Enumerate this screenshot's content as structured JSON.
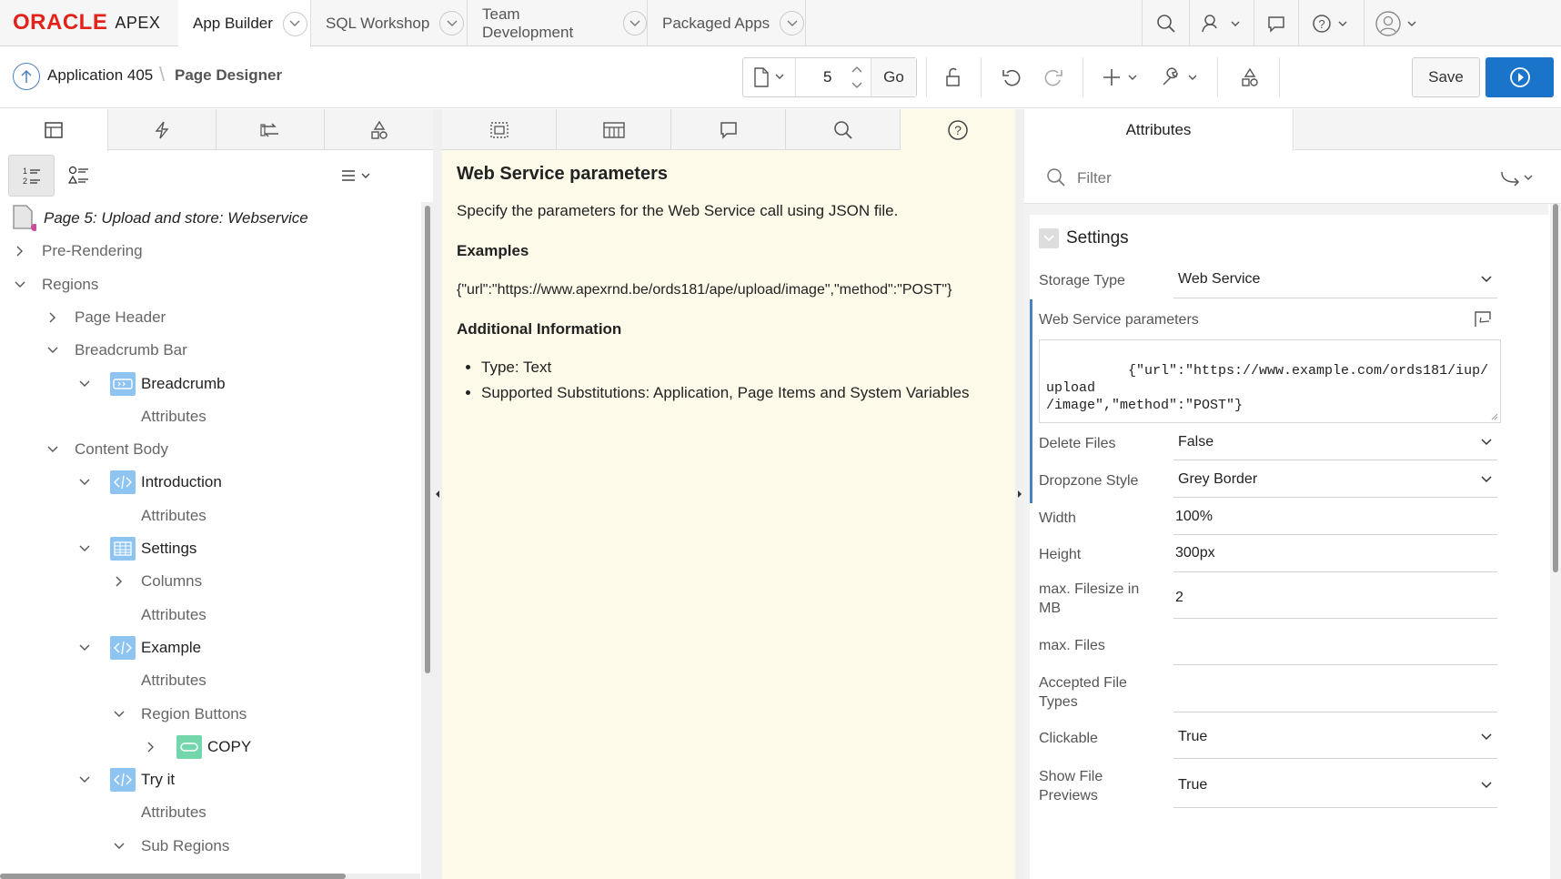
{
  "brand": {
    "oracle": "ORACLE",
    "apex": "APEX"
  },
  "nav": {
    "tabs": [
      {
        "label": "App Builder"
      },
      {
        "label": "SQL Workshop"
      },
      {
        "label": "Team Development"
      },
      {
        "label": "Packaged Apps"
      }
    ],
    "icons": [
      "search-icon",
      "user-icon",
      "chat-icon",
      "help-icon",
      "account-icon"
    ]
  },
  "toolbar": {
    "app": "Application 405",
    "separator": "\\",
    "page_designer": "Page Designer",
    "page_number": "5",
    "go": "Go",
    "save": "Save"
  },
  "tree": {
    "page_title": "Page 5: Upload and store: Webservice",
    "nodes": [
      {
        "label": "Pre-Rendering"
      },
      {
        "label": "Regions"
      },
      {
        "label": "Page Header"
      },
      {
        "label": "Breadcrumb Bar"
      },
      {
        "label": "Breadcrumb"
      },
      {
        "label": "Attributes"
      },
      {
        "label": "Content Body"
      },
      {
        "label": "Introduction"
      },
      {
        "label": "Attributes"
      },
      {
        "label": "Settings"
      },
      {
        "label": "Columns"
      },
      {
        "label": "Attributes"
      },
      {
        "label": "Example"
      },
      {
        "label": "Attributes"
      },
      {
        "label": "Region Buttons"
      },
      {
        "label": "COPY"
      },
      {
        "label": "Try it"
      },
      {
        "label": "Attributes"
      },
      {
        "label": "Sub Regions"
      }
    ]
  },
  "help": {
    "title": "Web Service parameters",
    "description": "Specify the parameters for the Web Service call using JSON file.",
    "examples_heading": "Examples",
    "example": "{\"url\":\"https://www.apexrnd.be/ords181/ape/upload/image\",\"method\":\"POST\"}",
    "additional_heading": "Additional Information",
    "bullets": [
      "Type: Text",
      "Supported Substitutions: Application, Page Items and System Variables"
    ]
  },
  "attributes": {
    "tab": "Attributes",
    "filter_placeholder": "Filter",
    "group": "Settings",
    "storage_type": {
      "label": "Storage Type",
      "value": "Web Service"
    },
    "ws_params": {
      "label": "Web Service parameters",
      "value": "{\"url\":\"https://www.example.com/ords181/iup/upload\n/image\",\"method\":\"POST\"}"
    },
    "delete_files": {
      "label": "Delete Files",
      "value": "False"
    },
    "dropzone_style": {
      "label": "Dropzone Style",
      "value": "Grey Border"
    },
    "width": {
      "label": "Width",
      "value": "100%"
    },
    "height": {
      "label": "Height",
      "value": "300px"
    },
    "max_filesize": {
      "label": "max. Filesize in MB",
      "value": "2"
    },
    "max_files": {
      "label": "max. Files",
      "value": ""
    },
    "accepted_types": {
      "label": "Accepted File Types",
      "value": ""
    },
    "clickable": {
      "label": "Clickable",
      "value": "True"
    },
    "show_previews": {
      "label": "Show File Previews",
      "value": "True"
    }
  },
  "colors": {
    "accent": "#1a74c9",
    "brand_red": "#e2231a",
    "help_bg": "#fdfaea"
  }
}
